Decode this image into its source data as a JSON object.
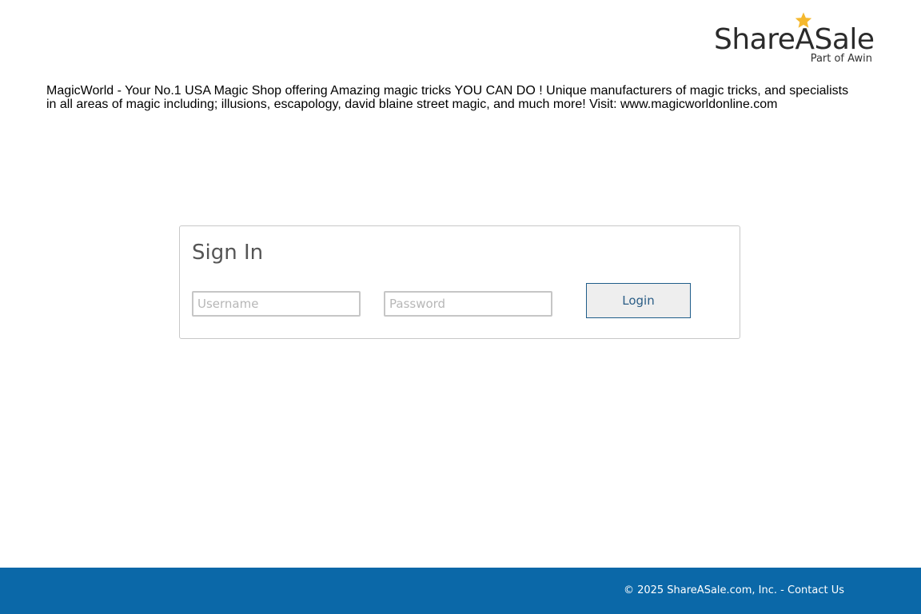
{
  "header": {
    "logo": {
      "wordmark": "ShareASale",
      "tagline": "Part of Awin",
      "star_color": "#f5b82e"
    }
  },
  "merchant": {
    "description": "MagicWorld - Your No.1 USA Magic Shop offering Amazing magic tricks YOU CAN DO ! Unique manufacturers of magic tricks, and specialists in all areas of magic including; illusions, escapology, david blaine street magic, and much more! Visit: www.magicworldonline.com"
  },
  "signin": {
    "title": "Sign In",
    "username_placeholder": "Username",
    "password_placeholder": "Password",
    "login_label": "Login"
  },
  "footer": {
    "copyright": "© 2025 ShareASale.com, Inc. - ",
    "contact_label": "Contact Us",
    "background_color": "#0b68a8"
  }
}
